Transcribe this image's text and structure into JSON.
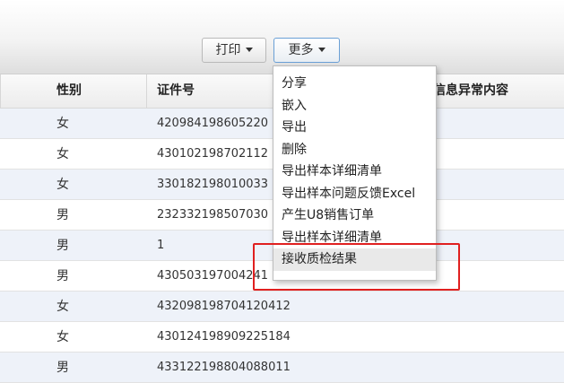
{
  "toolbar": {
    "print_label": "打印",
    "more_label": "更多"
  },
  "table": {
    "headers": {
      "gender": "性别",
      "id": "证件号",
      "abnormal": "信息异常内容"
    },
    "rows": [
      {
        "gender": "女",
        "id": "420984198605220"
      },
      {
        "gender": "女",
        "id": "430102198702112"
      },
      {
        "gender": "女",
        "id": "330182198010033"
      },
      {
        "gender": "男",
        "id": "232332198507030"
      },
      {
        "gender": "男",
        "id": "1"
      },
      {
        "gender": "男",
        "id": "430503197004241"
      },
      {
        "gender": "女",
        "id": "432098198704120412"
      },
      {
        "gender": "女",
        "id": "430124198909225184"
      },
      {
        "gender": "男",
        "id": "433122198804088011"
      }
    ]
  },
  "menu": {
    "items": [
      "分享",
      "嵌入",
      "导出",
      "删除",
      "导出样本详细清单",
      "导出样本问题反馈Excel",
      "产生U8销售订单",
      "导出样本详细清单",
      "接收质检结果"
    ],
    "hovered_index": 8
  },
  "colors": {
    "highlight": "#e02020",
    "row_alt": "#eef2f9"
  }
}
